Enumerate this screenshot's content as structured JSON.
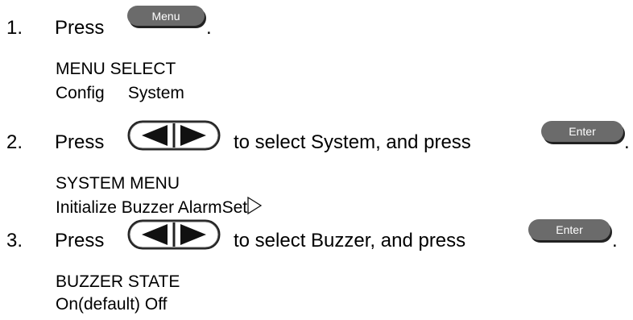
{
  "steps": [
    {
      "number": "1.",
      "text_before": "Press",
      "key_label": "Menu",
      "text_after": ".",
      "display_line1": "MENU SELECT",
      "display_line2": "Config     System"
    },
    {
      "number": "2.",
      "text_before": "Press",
      "text_middle": "to select System, and press",
      "key_label": "Enter",
      "text_after": ".",
      "display_line1": "SYSTEM MENU",
      "display_line2": "Initialize Buzzer AlarmSet"
    },
    {
      "number": "3.",
      "text_before": "Press",
      "text_middle": "to select Buzzer, and press",
      "key_label": "Enter",
      "text_after": ".",
      "display_line1": "BUZZER STATE",
      "display_line2": "On(default) Off"
    }
  ],
  "icons": {
    "arrow_keys": "left-right-arrow-keys-icon",
    "more": "right-triangle-outline-icon"
  },
  "colors": {
    "key_bg": "#6b6b6b",
    "key_text": "#ffffff",
    "text": "#000000"
  }
}
